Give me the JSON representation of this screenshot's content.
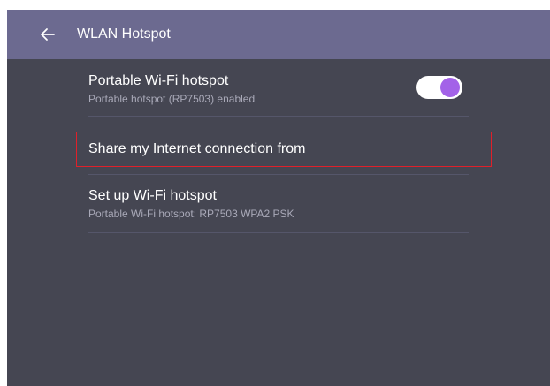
{
  "header": {
    "title": "WLAN Hotspot",
    "back_icon": "arrow-left-icon"
  },
  "settings": [
    {
      "title": "Portable Wi-Fi hotspot",
      "subtitle": "Portable hotspot (RP7503) enabled",
      "toggle_on": true
    },
    {
      "title": "Share my Internet connection from",
      "highlighted": true
    },
    {
      "title": "Set up Wi-Fi hotspot",
      "subtitle": "Portable Wi-Fi hotspot: RP7503 WPA2 PSK"
    }
  ],
  "colors": {
    "appbar": "#6c6a90",
    "background": "#454652",
    "toggle_accent": "#a362e8",
    "highlight_border": "#e0202a"
  }
}
